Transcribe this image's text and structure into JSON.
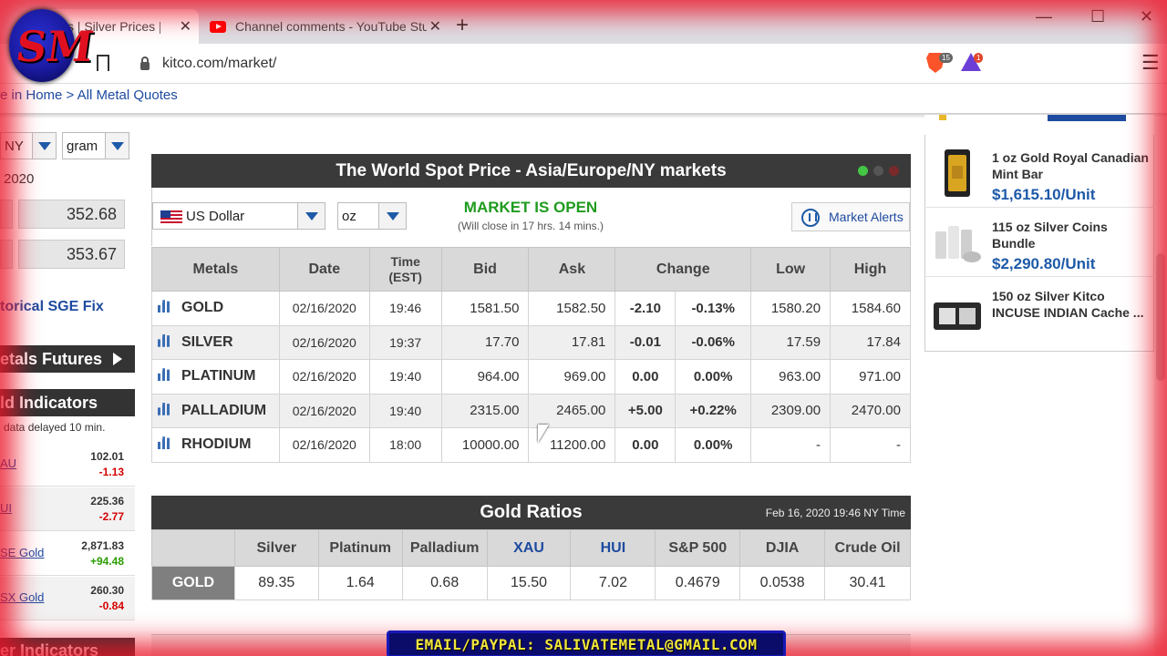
{
  "browser": {
    "tabs": [
      {
        "title": "ices | Silver Prices | Pla",
        "active": true
      },
      {
        "title": "Channel comments - YouTube Stu",
        "active": false
      }
    ],
    "new_tab": "+",
    "window_controls": [
      "—",
      "☐",
      "✕"
    ],
    "url": "kitco.com/market/",
    "brave_badge": "15",
    "rewards_badge": "1",
    "menu": "☰"
  },
  "breadcrumb": {
    "prefix": "e in ",
    "home": "Home",
    "separator": " > ",
    "current": "All Metal Quotes"
  },
  "sidebar": {
    "market_select": "NY",
    "unit_select": "gram",
    "year_text": "2020",
    "price_1": "352.68",
    "price_2": "353.67",
    "sge_link": "torical SGE Fix",
    "futures_bar": "etals Futures",
    "indicators_bar": "ld Indicators",
    "delay_note": "data delayed 10 min.",
    "indicators": [
      {
        "name": "AU",
        "value": "102.01",
        "change": "-1.13",
        "dir": "neg"
      },
      {
        "name": "UI",
        "value": "225.36",
        "change": "-2.77",
        "dir": "neg"
      },
      {
        "name": "SE Gold",
        "value": "2,871.83",
        "change": "+94.48",
        "dir": "pos"
      },
      {
        "name": "SX Gold",
        "value": "260.30",
        "change": "-0.84",
        "dir": "neg"
      }
    ],
    "other_bar": "er Indicators"
  },
  "spot": {
    "title": "The World Spot Price - Asia/Europe/NY markets",
    "currency": "US Dollar",
    "unit": "oz",
    "status": "MARKET IS OPEN",
    "close_note": "(Will close in 17 hrs. 14 mins.)",
    "alerts_label": "Market Alerts",
    "status_colors": [
      "#44c744",
      "#555555",
      "#7a2a2a"
    ],
    "headers": {
      "metals": "Metals",
      "date": "Date",
      "time_line1": "Time",
      "time_line2": "(EST)",
      "bid": "Bid",
      "ask": "Ask",
      "change": "Change",
      "low": "Low",
      "high": "High"
    },
    "rows": [
      {
        "metal": "GOLD",
        "date": "02/16/2020",
        "time": "19:46",
        "bid": "1581.50",
        "ask": "1582.50",
        "chg": "-2.10",
        "pct": "-0.13%",
        "low": "1580.20",
        "high": "1584.60",
        "dir": "neg"
      },
      {
        "metal": "SILVER",
        "date": "02/16/2020",
        "time": "19:37",
        "bid": "17.70",
        "ask": "17.81",
        "chg": "-0.01",
        "pct": "-0.06%",
        "low": "17.59",
        "high": "17.84",
        "dir": "neg"
      },
      {
        "metal": "PLATINUM",
        "date": "02/16/2020",
        "time": "19:40",
        "bid": "964.00",
        "ask": "969.00",
        "chg": "0.00",
        "pct": "0.00%",
        "low": "963.00",
        "high": "971.00",
        "dir": "neutral"
      },
      {
        "metal": "PALLADIUM",
        "date": "02/16/2020",
        "time": "19:40",
        "bid": "2315.00",
        "ask": "2465.00",
        "chg": "+5.00",
        "pct": "+0.22%",
        "low": "2309.00",
        "high": "2470.00",
        "dir": "pos"
      },
      {
        "metal": "RHODIUM",
        "date": "02/16/2020",
        "time": "18:00",
        "bid": "10000.00",
        "ask": "11200.00",
        "chg": "0.00",
        "pct": "0.00%",
        "low": "-",
        "high": "-",
        "dir": "neutral"
      }
    ]
  },
  "ratios": {
    "title": "Gold Ratios",
    "timestamp": "Feb 16, 2020 19:46 NY Time",
    "row_label": "GOLD",
    "columns": [
      "Silver",
      "Platinum",
      "Palladium",
      "XAU",
      "HUI",
      "S&P 500",
      "DJIA",
      "Crude Oil"
    ],
    "values": [
      "89.35",
      "1.64",
      "0.68",
      "15.50",
      "7.02",
      "0.4679",
      "0.0538",
      "30.41"
    ]
  },
  "products": [
    {
      "name": "1 oz Gold Royal Canadian Mint Bar",
      "price": "$1,615.10/Unit"
    },
    {
      "name": "115 oz Silver Coins Bundle",
      "price": "$2,290.80/Unit"
    },
    {
      "name": "150 oz Silver Kitco INCUSE INDIAN Cache ...",
      "price": ""
    }
  ],
  "overlay": {
    "email": "EMAIL/PAYPAL: SALIVATEMETAL@GMAIL.COM"
  }
}
